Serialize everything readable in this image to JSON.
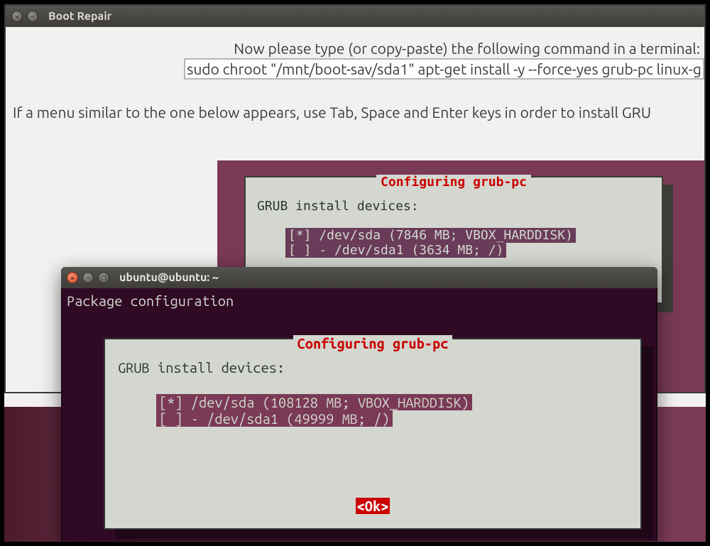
{
  "boot_repair": {
    "title": "Boot Repair",
    "instruction": "Now please type (or copy-paste) the following command in a terminal:",
    "command": "sudo chroot \"/mnt/boot-sav/sda1\" apt-get install -y --force-yes grub-pc linux-g",
    "tab_hint": "If a menu similar to the one below appears, use Tab, Space and Enter keys in order to install GRU",
    "illustration": {
      "title": "Configuring grub-pc",
      "label": "GRUB install devices:",
      "device1": "[*] /dev/sda (7846 MB; VBOX_HARDDISK)",
      "device2": "[ ] - /dev/sda1 (3634 MB; /)"
    }
  },
  "terminal": {
    "title": "ubuntu@ubuntu: ~",
    "pkgconf": "Package configuration",
    "dialog": {
      "title": "Configuring grub-pc",
      "label": "GRUB install devices:",
      "device1": "[*] /dev/sda (108128 MB; VBOX_HARDDISK)",
      "device2": "[ ] - /dev/sda1 (49999 MB; /)",
      "ok": "<Ok>"
    }
  },
  "icons": {
    "close_x": "×",
    "minimize": "–",
    "maximize": "□"
  }
}
